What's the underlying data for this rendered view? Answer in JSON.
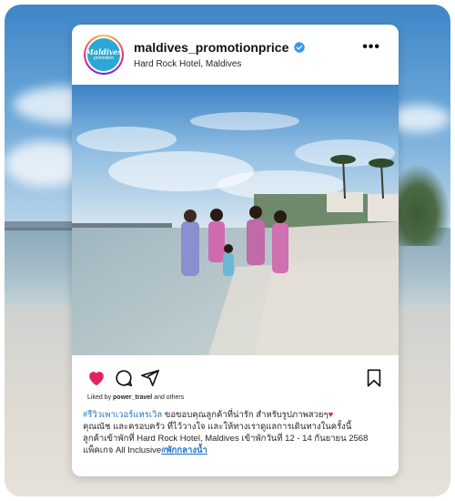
{
  "post": {
    "username": "maldives_promotionprice",
    "location": "Hard Rock Hotel, Maldives",
    "more_icon": "more-horizontal-icon",
    "avatar": {
      "line1": "Maldives",
      "line2": "promotion"
    },
    "likes": {
      "prefix": "Liked by",
      "user": "power_travel",
      "suffix": "and others"
    },
    "caption": {
      "hashtag1": "#รีวิวเพาเวอร์แทรเวิล",
      "line1": " ขอขอบคุณลูกค้าที่น่ารัก สำหรับรูปภาพสวยๆ",
      "line2": "คุณณัช และครอบครัว ที่ไว้วางใจ และให้ทางเราดูแลการเดินทางในครั้งนี้",
      "line3": "ลูกค้าเข้าพักที่ Hard Rock Hotel, Maldives เข้าพักวันที่ 12 - 14 กันยายน 2568",
      "line4": "แพ็คเกจ All Inclusive",
      "hashtag2": "#พักกลางน้ำ"
    },
    "icons": [
      "heart-icon",
      "comment-icon",
      "share-icon",
      "bookmark-icon"
    ],
    "colors": {
      "like": "#e0245e",
      "hashtag": "#1a73c9",
      "verified": "#3797f0"
    }
  }
}
